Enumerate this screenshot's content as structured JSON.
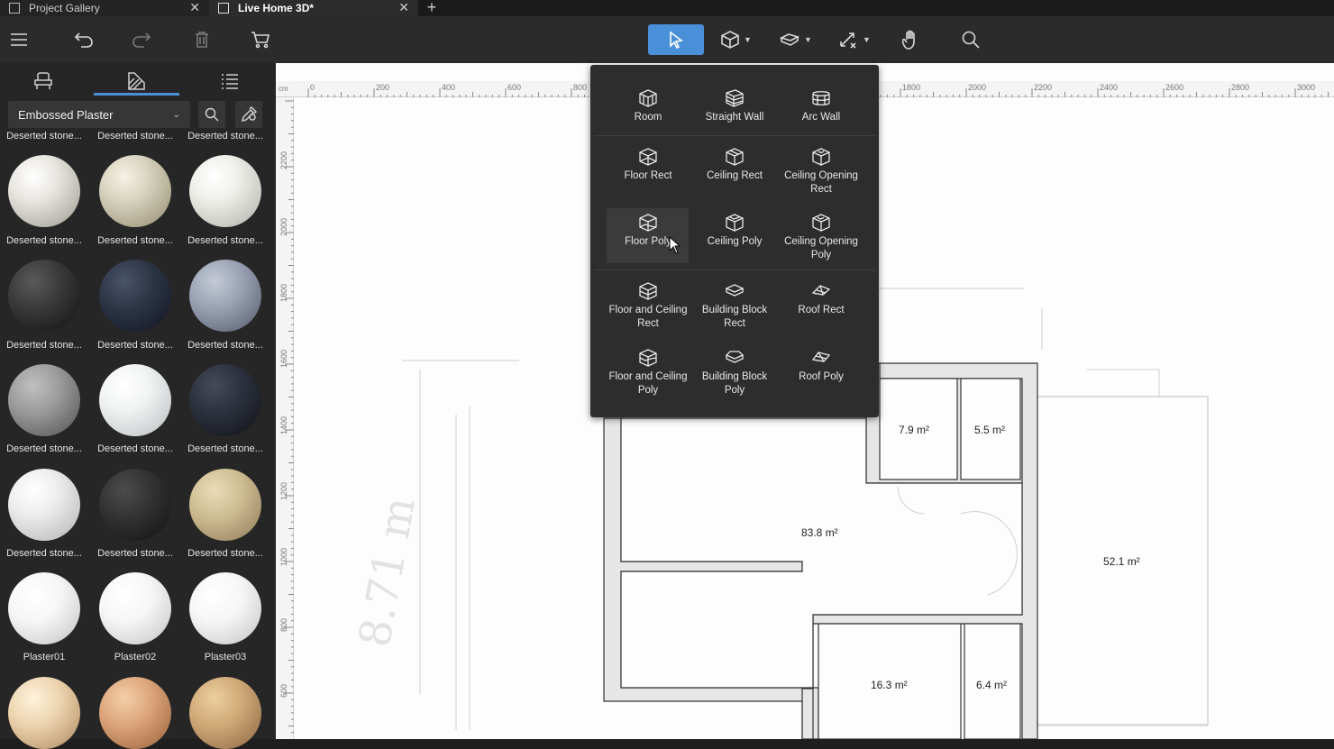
{
  "tabs": [
    {
      "label": "Project Gallery"
    },
    {
      "label": "Live Home 3D*"
    }
  ],
  "panel": {
    "material_dropdown": "Embossed Plaster"
  },
  "materials": {
    "row0": [
      "Deserted stone...",
      "Deserted stone...",
      "Deserted stone..."
    ],
    "row1": [
      "Deserted stone...",
      "Deserted stone...",
      "Deserted stone..."
    ],
    "row2": [
      "Deserted stone...",
      "Deserted stone...",
      "Deserted stone..."
    ],
    "row3": [
      "Deserted stone...",
      "Deserted stone...",
      "Deserted stone..."
    ],
    "row4": [
      "Deserted stone...",
      "Deserted stone...",
      "Deserted stone..."
    ],
    "row5": [
      "Plaster01",
      "Plaster02",
      "Plaster03"
    ]
  },
  "ruler": {
    "unit": "cm",
    "top": [
      "0",
      "200",
      "400",
      "600",
      "800",
      "1800",
      "2000",
      "2200",
      "2400",
      "2600",
      "2800",
      "3000"
    ],
    "left": [
      "2200",
      "2000",
      "1800",
      "1600",
      "1400",
      "1200",
      "1000",
      "800",
      "600"
    ]
  },
  "popup": {
    "room": "Room",
    "straight_wall": "Straight Wall",
    "arc_wall": "Arc Wall",
    "floor_rect": "Floor Rect",
    "ceiling_rect": "Ceiling Rect",
    "ceiling_opening_rect": "Ceiling Opening Rect",
    "floor_poly": "Floor Poly",
    "ceiling_poly": "Ceiling Poly",
    "ceiling_opening_poly": "Ceiling Opening Poly",
    "floor_ceiling_rect": "Floor and Ceiling Rect",
    "building_block_rect": "Building Block Rect",
    "roof_rect": "Roof Rect",
    "floor_ceiling_poly": "Floor and Ceiling Poly",
    "building_block_poly": "Building Block Poly",
    "roof_poly": "Roof Poly"
  },
  "areas": {
    "a1": "7.9 m²",
    "a2": "5.5 m²",
    "a3": "83.8 m²",
    "a4": "52.1 m²",
    "a5": "16.3 m²",
    "a6": "6.4 m²"
  },
  "sketch_text": "8.71 m",
  "colors": {
    "accent": "#4a90d9",
    "toolbar": "#2b2b2b",
    "panel": "#262626",
    "popup": "#2d2d2d"
  }
}
